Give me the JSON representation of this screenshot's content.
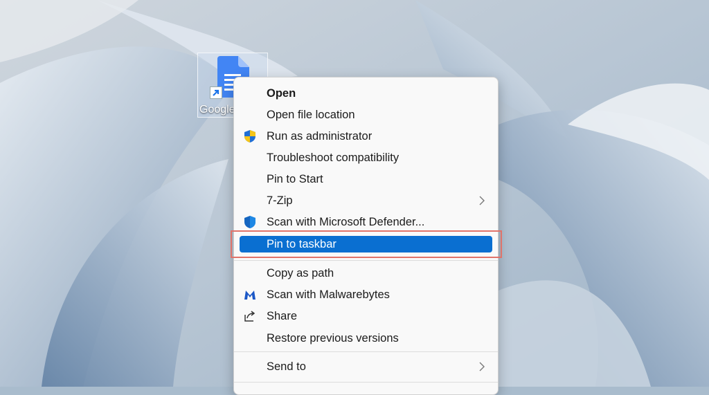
{
  "desktop": {
    "icon_label": "Google Docs"
  },
  "context_menu": {
    "items": [
      {
        "label": "Open"
      },
      {
        "label": "Open file location"
      },
      {
        "label": "Run as administrator",
        "icon": "uac-shield-icon"
      },
      {
        "label": "Troubleshoot compatibility"
      },
      {
        "label": "Pin to Start"
      },
      {
        "label": "7-Zip",
        "submenu": true
      },
      {
        "label": "Scan with Microsoft Defender...",
        "icon": "defender-shield-icon"
      },
      {
        "label": "Pin to taskbar",
        "selected": true
      },
      {
        "label": "Copy as path"
      },
      {
        "label": "Scan with Malwarebytes",
        "icon": "malwarebytes-icon"
      },
      {
        "label": "Share",
        "icon": "share-icon"
      },
      {
        "label": "Restore previous versions"
      },
      {
        "label": "Send to",
        "submenu": true
      }
    ]
  },
  "colors": {
    "selection": "#0a6fd1",
    "callout_border": "#e0736a",
    "menu_background": "#f9f9f9"
  }
}
